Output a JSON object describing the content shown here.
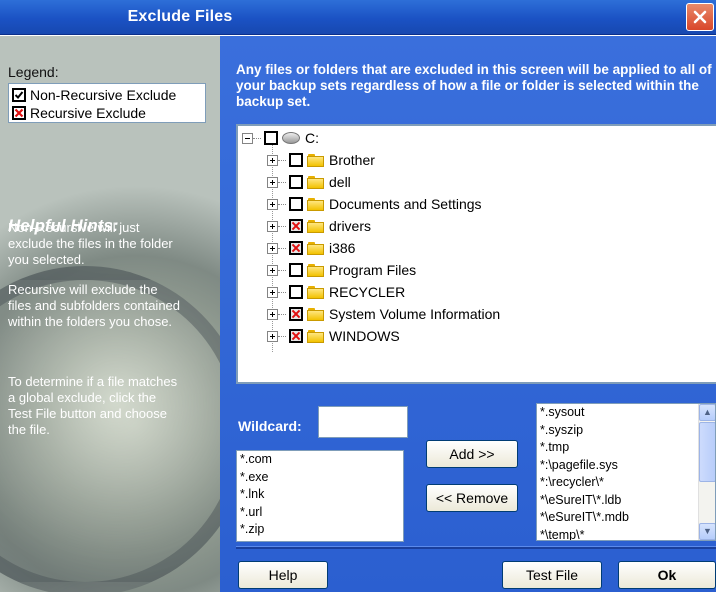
{
  "window": {
    "title": "Exclude Files"
  },
  "legend": {
    "label": "Legend:",
    "items": [
      {
        "label": "Non-Recursive Exclude",
        "state": "checked"
      },
      {
        "label": "Recursive Exclude",
        "state": "recursive"
      }
    ]
  },
  "hints": {
    "title": "Helpful Hints:",
    "paragraphs": [
      "Non-Recursive will just exclude the files in the folder you selected.",
      "Recursive will exclude the files and subfolders contained within the folders you chose.",
      "To determine if a file matches a global exclude, click the Test File button and choose the file."
    ]
  },
  "description": "Any files or folders that are excluded in this screen will be applied to all of your backup sets regardless of how a file or folder is selected within the backup set.",
  "tree": {
    "root": {
      "label": "C:"
    },
    "items": [
      {
        "label": "Brother",
        "state": "unchecked"
      },
      {
        "label": "dell",
        "state": "unchecked"
      },
      {
        "label": "Documents and Settings",
        "state": "unchecked"
      },
      {
        "label": "drivers",
        "state": "recursive"
      },
      {
        "label": "i386",
        "state": "recursive"
      },
      {
        "label": "Program Files",
        "state": "unchecked"
      },
      {
        "label": "RECYCLER",
        "state": "unchecked"
      },
      {
        "label": "System Volume Information",
        "state": "recursive"
      },
      {
        "label": "WINDOWS",
        "state": "recursive"
      }
    ]
  },
  "wildcard": {
    "label": "Wildcard:",
    "value": "",
    "available": [
      "*.com",
      "*.exe",
      "*.lnk",
      "*.url",
      "*.zip"
    ],
    "excluded": [
      "*.sysout",
      "*.syszip",
      "*.tmp",
      "*:\\pagefile.sys",
      "*:\\recycler\\*",
      "*\\eSureIT\\*.ldb",
      "*\\eSureIT\\*.mdb",
      "*\\temp\\*"
    ]
  },
  "buttons": {
    "add": "Add >>",
    "remove": "<< Remove",
    "help": "Help",
    "test_file": "Test File",
    "ok": "Ok"
  }
}
